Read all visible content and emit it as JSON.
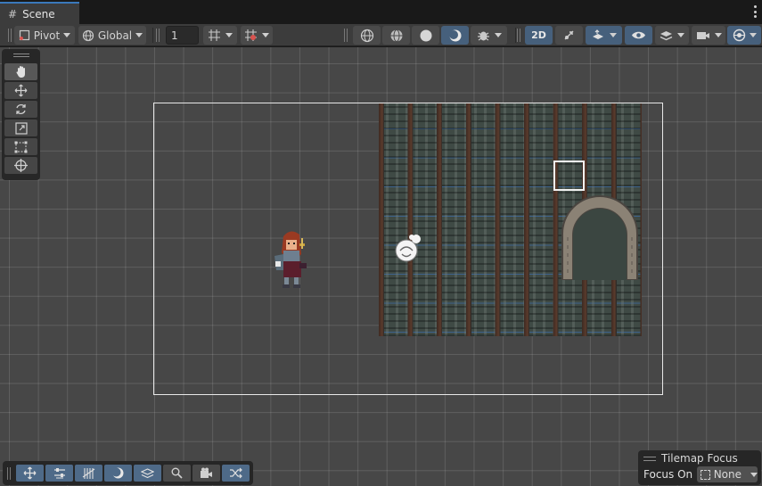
{
  "tab": {
    "title": "Scene",
    "icon": "grid-icon"
  },
  "toolbar": {
    "pivot_label": "Pivot",
    "global_label": "Global",
    "grid_snap_value": "1",
    "mode_2d_label": "2D"
  },
  "scene": {
    "grid_color": "#5b5b5b",
    "background_color": "#474747"
  },
  "tools": [
    "view-tool",
    "move-tool",
    "rotate-tool",
    "scale-tool",
    "rect-tool",
    "transform-tool"
  ],
  "bottom_overlay": [
    "move-icon",
    "sliders-icon",
    "tiles-icon",
    "shading-icon",
    "layers-icon",
    "search-icon",
    "camera-icon",
    "shuffle-icon"
  ],
  "tilemap_focus": {
    "title": "Tilemap Focus",
    "focus_label": "Focus On",
    "focus_value": "None"
  }
}
